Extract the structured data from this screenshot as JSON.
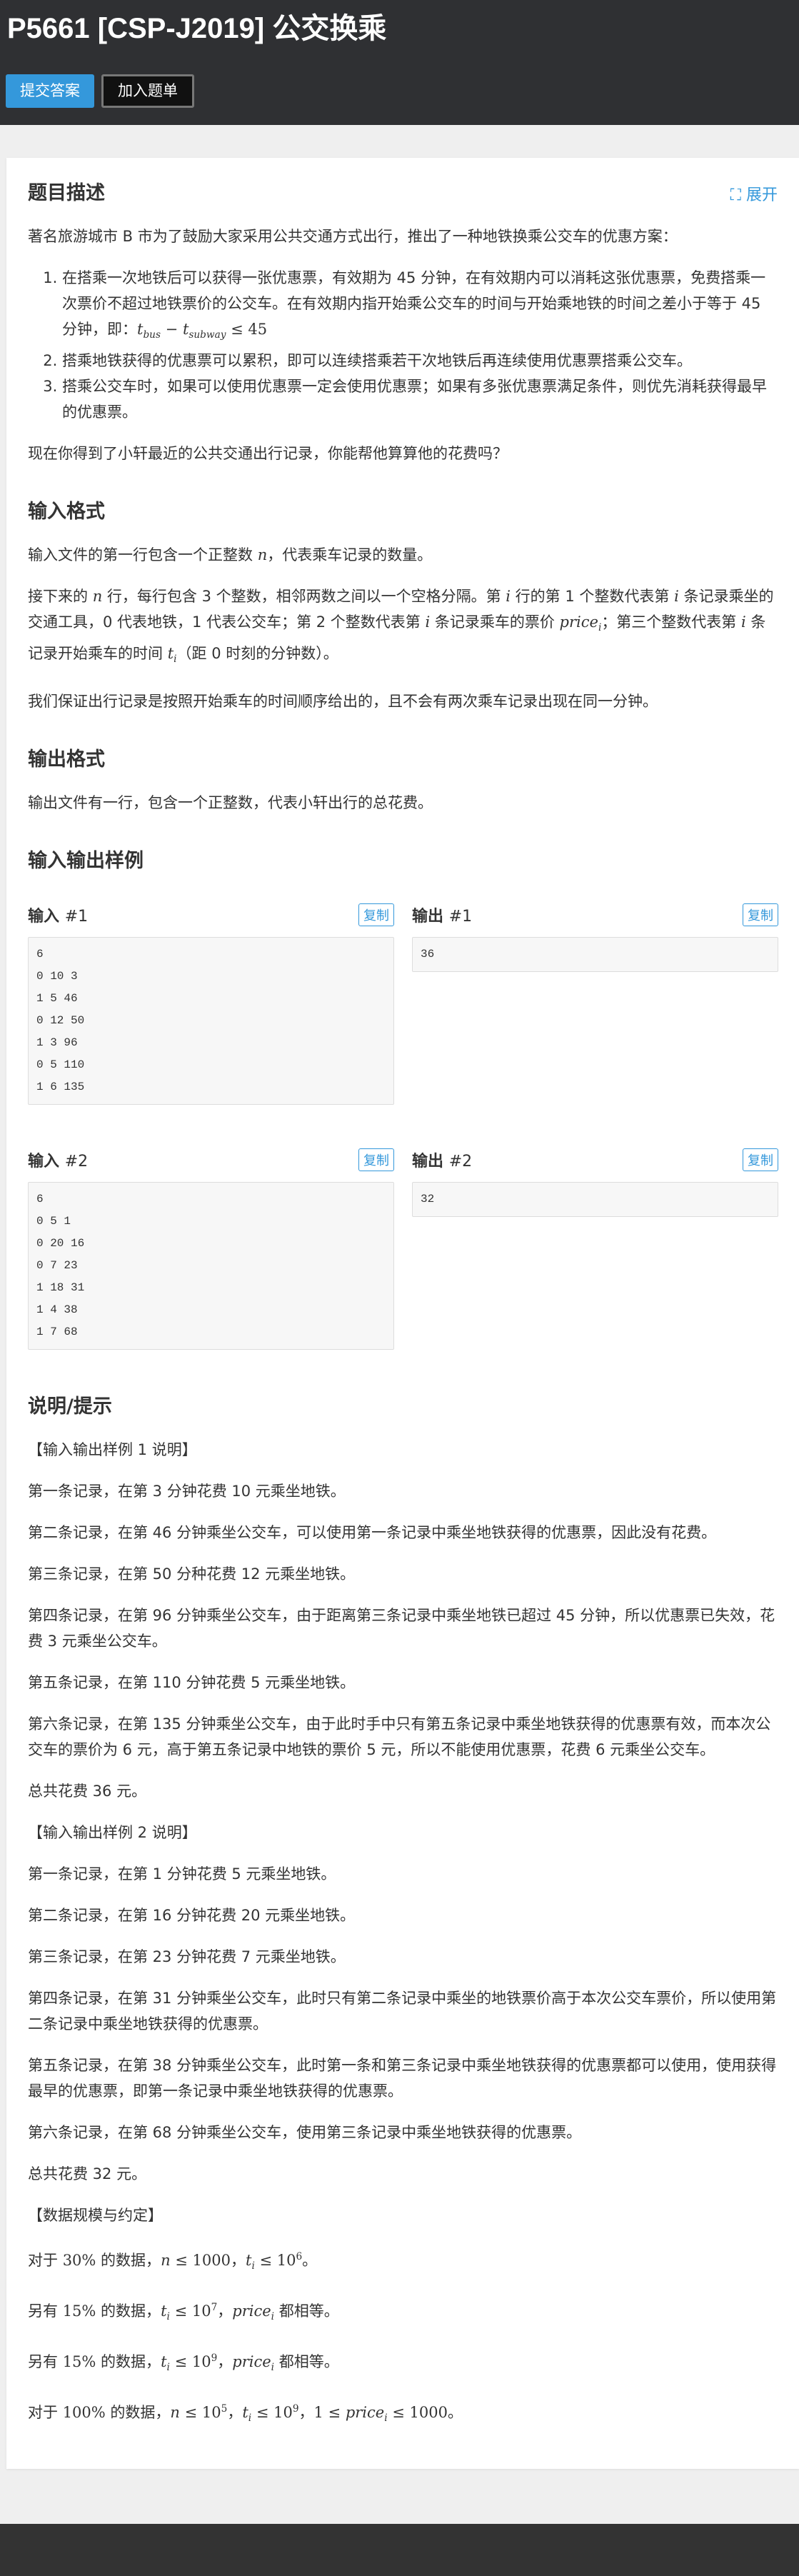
{
  "header": {
    "pid": "P5661 [CSP-J2019]",
    "name": "公交换乘",
    "submit_label": "提交答案",
    "add_label": "加入题单"
  },
  "desc": {
    "title": "题目描述",
    "expand_label": "展开",
    "intro": [
      "著名旅游城市 B 市为了鼓励大家采用公共交通方式出行，推出了一种地铁换乘公交车的优惠方案："
    ],
    "list": [
      [
        "在搭乘一次地铁后可以获得一张优惠票，有效期为 45 分钟，在有效期内可以消耗这张优惠票，免费搭乘一次票价不超过地铁票价的公交车。在有效期内指开始乘公交车的时间与开始乘地铁的时间之差小于等于 45 分钟，即：",
        {
          "m": "t",
          "sub": "bus"
        },
        {
          "n": " − "
        },
        {
          "m": "t",
          "sub": "subway"
        },
        {
          "n": " ≤ 45"
        }
      ],
      [
        "搭乘地铁获得的优惠票可以累积，即可以连续搭乘若干次地铁后再连续使用优惠票搭乘公交车。"
      ],
      [
        "搭乘公交车时，如果可以使用优惠票一定会使用优惠票；如果有多张优惠票满足条件，则优先消耗获得最早的优惠票。"
      ]
    ],
    "outro": [
      "现在你得到了小轩最近的公共交通出行记录，你能帮他算算他的花费吗？"
    ]
  },
  "input_format": {
    "title": "输入格式",
    "paras": [
      [
        "输入文件的第一行包含一个正整数 ",
        {
          "m": "n"
        },
        "，代表乘车记录的数量。"
      ],
      [
        "接下来的 ",
        {
          "m": "n"
        },
        " 行，每行包含 3 个整数，相邻两数之间以一个空格分隔。第 ",
        {
          "m": "i"
        },
        " 行的第 1 个整数代表第 ",
        {
          "m": "i"
        },
        " 条记录乘坐的交通工具，0 代表地铁，1 代表公交车；第 2 个整数代表第 ",
        {
          "m": "i"
        },
        " 条记录乘车的票价 ",
        {
          "m": "price",
          "sub": "i"
        },
        "；第三个整数代表第 ",
        {
          "m": "i"
        },
        " 条记录开始乘车的时间 ",
        {
          "m": "t",
          "sub": "i"
        },
        "（距 0 时刻的分钟数）。"
      ],
      [
        "我们保证出行记录是按照开始乘车的时间顺序给出的，且不会有两次乘车记录出现在同一分钟。"
      ]
    ]
  },
  "output_format": {
    "title": "输出格式",
    "paras": [
      [
        "输出文件有一行，包含一个正整数，代表小轩出行的总花费。"
      ]
    ]
  },
  "samples": {
    "title": "输入输出样例",
    "copy_label": "复制",
    "items": [
      {
        "in_label": "输入",
        "in_num": "#1",
        "input": "6\n0 10 3\n1 5 46\n0 12 50\n1 3 96\n0 5 110\n1 6 135",
        "out_label": "输出",
        "out_num": "#1",
        "output": "36"
      },
      {
        "in_label": "输入",
        "in_num": "#2",
        "input": "6\n0 5 1\n0 20 16\n0 7 23\n1 18 31\n1 4 38\n1 7 68",
        "out_label": "输出",
        "out_num": "#2",
        "output": "32"
      }
    ]
  },
  "hint": {
    "title": "说明/提示",
    "paras": [
      [
        "【输入输出样例 1 说明】"
      ],
      [
        "第一条记录，在第 3 分钟花费 10 元乘坐地铁。"
      ],
      [
        "第二条记录，在第 46 分钟乘坐公交车，可以使用第一条记录中乘坐地铁获得的优惠票，因此没有花费。"
      ],
      [
        "第三条记录，在第 50 分种花费 12 元乘坐地铁。"
      ],
      [
        "第四条记录，在第 96 分钟乘坐公交车，由于距离第三条记录中乘坐地铁已超过 45 分钟，所以优惠票已失效，花费 3 元乘坐公交车。"
      ],
      [
        "第五条记录，在第 110 分钟花费 5 元乘坐地铁。"
      ],
      [
        "第六条记录，在第 135 分钟乘坐公交车，由于此时手中只有第五条记录中乘坐地铁获得的优惠票有效，而本次公交车的票价为 6 元，高于第五条记录中地铁的票价 5 元，所以不能使用优惠票，花费 6 元乘坐公交车。"
      ],
      [
        "总共花费 36 元。"
      ],
      [
        "【输入输出样例 2 说明】"
      ],
      [
        "第一条记录，在第 1 分钟花费 5 元乘坐地铁。"
      ],
      [
        "第二条记录，在第 16 分钟花费 20 元乘坐地铁。"
      ],
      [
        "第三条记录，在第 23 分钟花费 7 元乘坐地铁。"
      ],
      [
        "第四条记录，在第 31 分钟乘坐公交车，此时只有第二条记录中乘坐的地铁票价高于本次公交车票价，所以使用第二条记录中乘坐地铁获得的优惠票。"
      ],
      [
        "第五条记录，在第 38 分钟乘坐公交车，此时第一条和第三条记录中乘坐地铁获得的优惠票都可以使用，使用获得最早的优惠票，即第一条记录中乘坐地铁获得的优惠票。"
      ],
      [
        "第六条记录，在第 68 分钟乘坐公交车，使用第三条记录中乘坐地铁获得的优惠票。"
      ],
      [
        "总共花费 32 元。"
      ],
      [
        "【数据规模与约定】"
      ],
      [
        "对于 ",
        {
          "n": "30%"
        },
        " 的数据，",
        {
          "m": "n"
        },
        {
          "n": " ≤ 1000"
        },
        "，",
        {
          "m": "t",
          "sub": "i"
        },
        {
          "n": " ≤ 10",
          "sup": "6"
        },
        "。"
      ],
      [
        "另有 ",
        {
          "n": "15%"
        },
        " 的数据，",
        {
          "m": "t",
          "sub": "i"
        },
        {
          "n": " ≤ 10",
          "sup": "7"
        },
        "，",
        {
          "m": "price",
          "sub": "i"
        },
        " 都相等。"
      ],
      [
        "另有 ",
        {
          "n": "15%"
        },
        " 的数据，",
        {
          "m": "t",
          "sub": "i"
        },
        {
          "n": " ≤ 10",
          "sup": "9"
        },
        "，",
        {
          "m": "price",
          "sub": "i"
        },
        " 都相等。"
      ],
      [
        "对于 ",
        {
          "n": "100%"
        },
        " 的数据，",
        {
          "m": "n"
        },
        {
          "n": " ≤ 10",
          "sup": "5"
        },
        "，",
        {
          "m": "t",
          "sub": "i"
        },
        {
          "n": " ≤ 10",
          "sup": "9"
        },
        "，",
        {
          "n": "1 ≤ "
        },
        {
          "m": "price",
          "sub": "i"
        },
        {
          "n": " ≤ 1000"
        },
        "。"
      ]
    ]
  },
  "colors": {
    "accent": "#3498db",
    "header_bg": "#2f3033",
    "page_bg": "#efefef"
  }
}
